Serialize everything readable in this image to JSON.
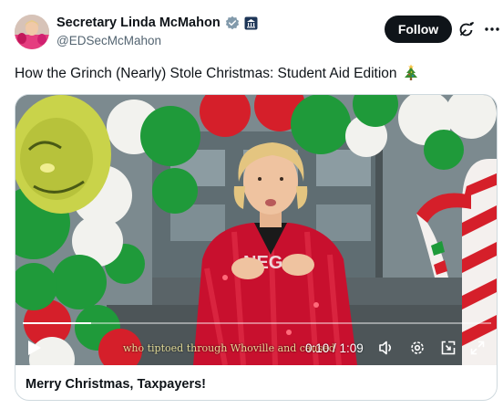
{
  "author": {
    "display_name": "Secretary Linda McMahon",
    "handle": "@EDSecMcMahon",
    "verified_badge_color": "#829aab",
    "avatar_icon": "profile-photo"
  },
  "actions": {
    "follow_label": "Follow",
    "grok_icon": "grok-icon",
    "more_icon": "more-icon"
  },
  "post": {
    "text": "How the Grinch (Nearly) Stole Christmas: Student Aid Edition",
    "emoji": "christmas-tree"
  },
  "video": {
    "subtitle": "who tiptoed through Whoville and caused",
    "current_time": "0:10",
    "duration": "1:09",
    "time_display": "0:10 / 1:09",
    "progress_fraction": 0.145,
    "controls": [
      "play-icon",
      "volume-icon",
      "settings-icon",
      "pip-icon",
      "fullscreen-icon"
    ]
  },
  "card": {
    "caption": "Merry Christmas, Taxpayers!"
  },
  "colors": {
    "text": "#0f1419",
    "muted": "#536471",
    "follow_bg": "#0f1419",
    "jacket": "#c8102e",
    "balloon_green": "#1f9a3a"
  }
}
